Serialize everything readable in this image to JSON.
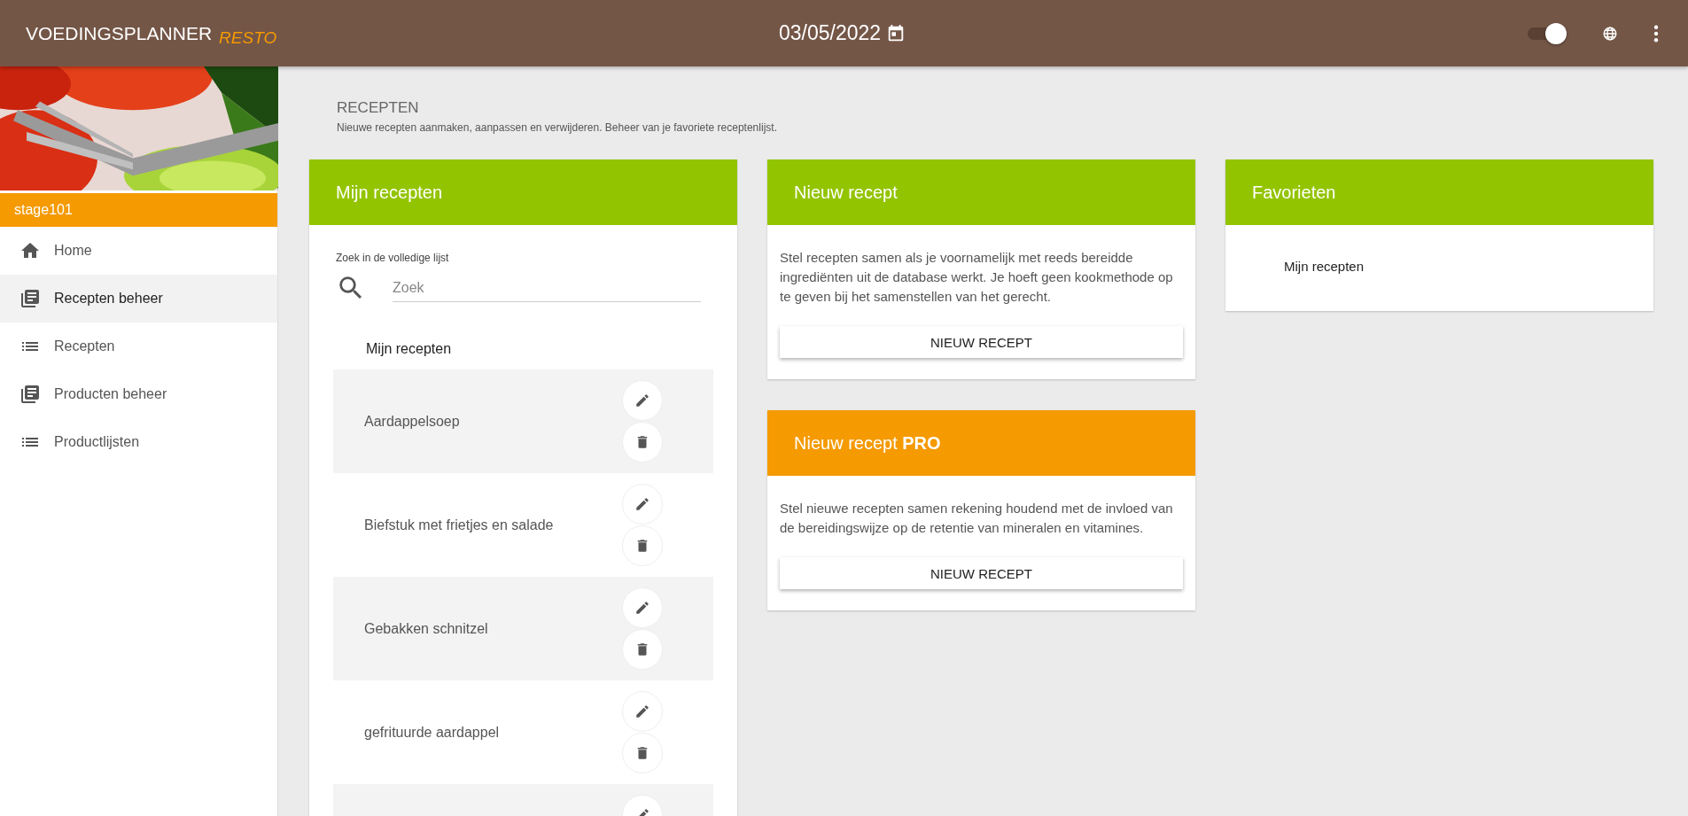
{
  "header": {
    "brand": "VOEDINGSPLANNER",
    "brand_suffix": "RESTO",
    "date": "03/05/2022",
    "toggle": {
      "on": true
    }
  },
  "sidebar": {
    "user": "stage101",
    "items": [
      {
        "label": "Home",
        "selected": false
      },
      {
        "label": "Recepten beheer",
        "selected": true
      },
      {
        "label": "Recepten",
        "selected": false
      },
      {
        "label": "Producten beheer",
        "selected": false
      },
      {
        "label": "Productlijsten",
        "selected": false
      }
    ]
  },
  "page": {
    "title": "RECEPTEN",
    "subtitle": "Nieuwe recepten aanmaken, aanpassen en verwijderen. Beheer van je favoriete receptenlijst."
  },
  "my_recipes": {
    "title": "Mijn recepten",
    "color": "#93c400",
    "search_label": "Zoek in de volledige lijst",
    "search": {
      "placeholder": "Zoek"
    },
    "list_title": "Mijn recepten",
    "rows": [
      {
        "name": "Aardappelsoep"
      },
      {
        "name": "Biefstuk met frietjes en salade"
      },
      {
        "name": "Gebakken schnitzel"
      },
      {
        "name": "gefrituurde aardappel"
      },
      {}
    ]
  },
  "new_recipe_cards": [
    {
      "title": "Nieuw recept",
      "color": "#93c400",
      "text": "Stel recepten samen als je voornamelijk met reeds bereidde ingrediënten uit de database werkt. Je hoeft geen kookmethode op te geven bij het samenstellen van het gerecht.",
      "button": "NIEUW RECEPT"
    },
    {
      "title": "Nieuw recept **PRO**",
      "color": "#f59a00",
      "text": "Stel nieuwe recepten samen rekening houdend met de invloed van de bereidingswijze op de retentie van mineralen en vitamines.",
      "button": "NIEUW RECEPT"
    }
  ],
  "favorites": {
    "title": "Favorieten",
    "color": "#93c400",
    "items": [
      "Mijn recepten"
    ]
  }
}
